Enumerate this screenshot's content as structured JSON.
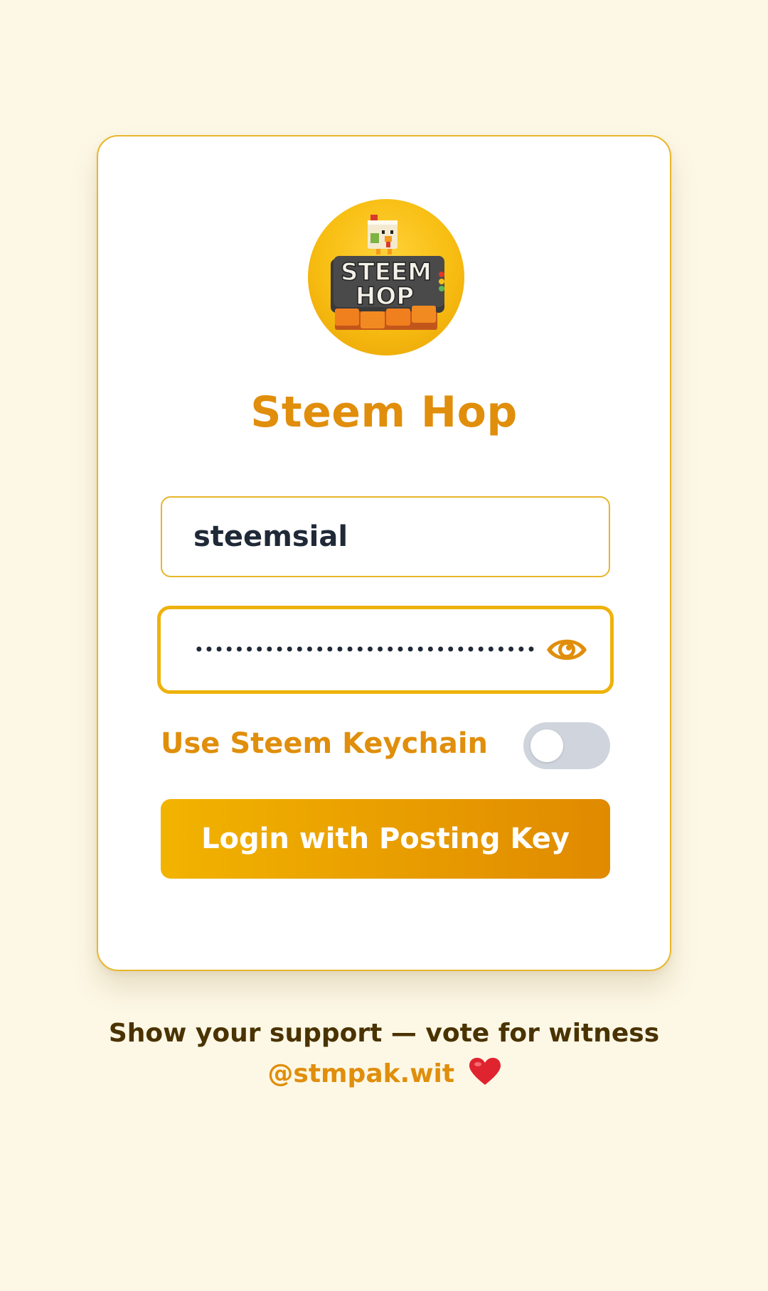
{
  "app": {
    "title": "Steem Hop",
    "logo": {
      "icon": "steem-hop-logo",
      "text": "STEEM HOP"
    }
  },
  "login_form": {
    "username": {
      "value": "steemsial"
    },
    "password": {
      "masked_value": "••••••••••••••••••••••••••••••••••••••••••••••••••••",
      "visibility_icon": "eye-icon"
    },
    "keychain_toggle": {
      "label": "Use Steem Keychain",
      "enabled": false
    },
    "submit_label": "Login with Posting Key"
  },
  "footer": {
    "support_text": "Show your support — vote for witness",
    "witness_link": "@stmpak.wit",
    "heart_icon": "heart-icon"
  },
  "colors": {
    "page_background": "#fdf8e6",
    "accent": "#e08e0b",
    "accent_gradient_start": "#f2b300",
    "accent_gradient_end": "#e08a00",
    "border": "#e8b62a",
    "toggle_off": "#cfd4dd",
    "text_dark": "#1f2937",
    "footer_text": "#4a3300"
  }
}
